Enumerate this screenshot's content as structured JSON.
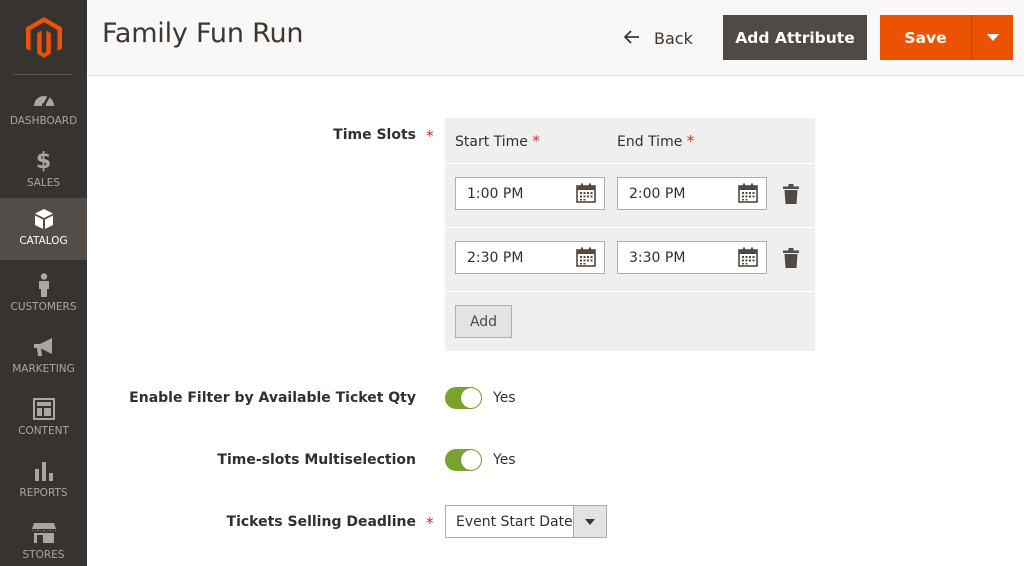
{
  "sidebar": {
    "logo": "magento-logo",
    "items": [
      {
        "label": "Dashboard",
        "icon": "dashboard-icon",
        "active": false
      },
      {
        "label": "Sales",
        "icon": "dollar-icon",
        "active": false
      },
      {
        "label": "Catalog",
        "icon": "box-icon",
        "active": true
      },
      {
        "label": "Customers",
        "icon": "person-icon",
        "active": false
      },
      {
        "label": "Marketing",
        "icon": "megaphone-icon",
        "active": false
      },
      {
        "label": "Content",
        "icon": "layout-icon",
        "active": false
      },
      {
        "label": "Reports",
        "icon": "bar-chart-icon",
        "active": false
      },
      {
        "label": "Stores",
        "icon": "storefront-icon",
        "active": false
      }
    ]
  },
  "header": {
    "title": "Family Fun Run",
    "back_label": "Back",
    "add_attribute_label": "Add Attribute",
    "save_label": "Save"
  },
  "colors": {
    "sidebar_bg": "#373330",
    "sidebar_active": "#524d49",
    "primary": "#eb5202",
    "secondary": "#514943",
    "toggle_on": "#79a22e",
    "required": "#e22626"
  },
  "form": {
    "time_slots": {
      "label": "Time Slots",
      "required_mark": "*",
      "start_header": "Start Time",
      "end_header": "End Time",
      "rows": [
        {
          "start": "1:00 PM",
          "end": "2:00 PM"
        },
        {
          "start": "2:30 PM",
          "end": "3:30 PM"
        }
      ],
      "add_label": "Add"
    },
    "filter_by_qty": {
      "label": "Enable Filter by Available Ticket Qty",
      "value": "Yes",
      "on": true
    },
    "multiselection": {
      "label": "Time-slots Multiselection",
      "value": "Yes",
      "on": true
    },
    "deadline": {
      "label": "Tickets Selling Deadline",
      "required_mark": "*",
      "selected": "Event Start Date"
    }
  }
}
